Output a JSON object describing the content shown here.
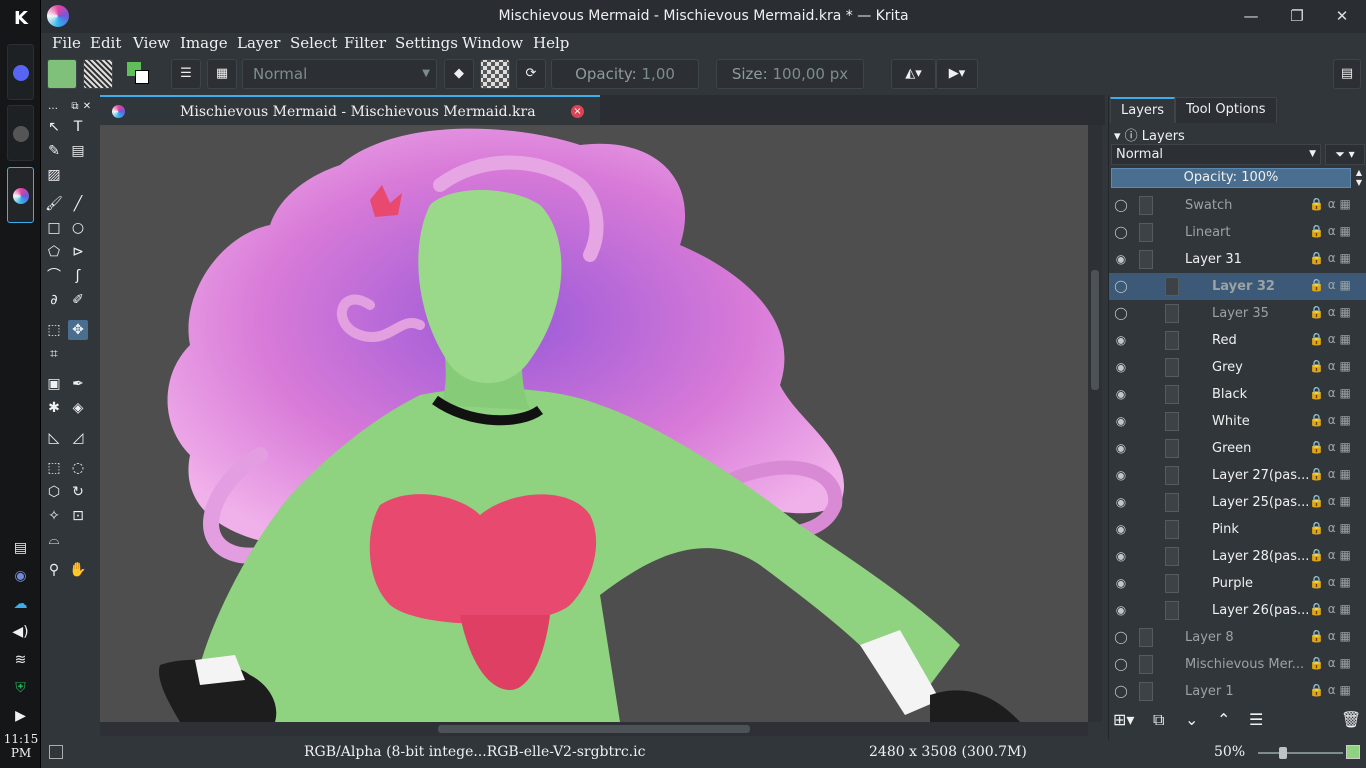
{
  "window": {
    "title": "Mischievous Mermaid - Mischievous Mermaid.kra * — Krita",
    "minimize": "—",
    "restore": "❐",
    "close": "✕"
  },
  "taskbar": {
    "launcher": "K",
    "clock": "11:15 PM"
  },
  "menu": [
    "File",
    "Edit",
    "View",
    "Image",
    "Layer",
    "Select",
    "Filter",
    "Settings",
    "Window",
    "Help"
  ],
  "toolbar": {
    "blend_mode": "Normal",
    "opacity_label": "Opacity:",
    "opacity_value": "1,00",
    "size_label": "Size:",
    "size_value": "100,00 px"
  },
  "canvas_tab": {
    "label": "Mischievous Mermaid - Mischievous Mermaid.kra"
  },
  "dock": {
    "tabs": [
      "Layers",
      "Tool Options"
    ],
    "header": "Layers",
    "blend_mode": "Normal",
    "opacity": "Opacity:  100%",
    "layers": [
      {
        "name": "Swatch",
        "indent": 0,
        "visible": false,
        "selected": false
      },
      {
        "name": "Lineart",
        "indent": 0,
        "visible": false,
        "selected": false
      },
      {
        "name": "Layer 31",
        "indent": 0,
        "visible": true,
        "selected": false
      },
      {
        "name": "Layer 32",
        "indent": 1,
        "visible": false,
        "selected": true
      },
      {
        "name": "Layer 35",
        "indent": 1,
        "visible": false,
        "selected": false
      },
      {
        "name": "Red",
        "indent": 1,
        "visible": true,
        "selected": false
      },
      {
        "name": "Grey",
        "indent": 1,
        "visible": true,
        "selected": false
      },
      {
        "name": "Black",
        "indent": 1,
        "visible": true,
        "selected": false
      },
      {
        "name": "White",
        "indent": 1,
        "visible": true,
        "selected": false
      },
      {
        "name": "Green",
        "indent": 1,
        "visible": true,
        "selected": false
      },
      {
        "name": "Layer 27(pas...",
        "indent": 1,
        "visible": true,
        "selected": false
      },
      {
        "name": "Layer 25(pas...",
        "indent": 1,
        "visible": true,
        "selected": false
      },
      {
        "name": "Pink",
        "indent": 1,
        "visible": true,
        "selected": false
      },
      {
        "name": "Layer 28(pas...",
        "indent": 1,
        "visible": true,
        "selected": false
      },
      {
        "name": "Purple",
        "indent": 1,
        "visible": true,
        "selected": false
      },
      {
        "name": "Layer 26(pas...",
        "indent": 1,
        "visible": true,
        "selected": false
      },
      {
        "name": "Layer 8",
        "indent": 0,
        "visible": false,
        "selected": false
      },
      {
        "name": "Mischievous Mer...",
        "indent": 0,
        "visible": false,
        "selected": false
      },
      {
        "name": "Layer 1",
        "indent": 0,
        "visible": false,
        "selected": false
      }
    ]
  },
  "status": {
    "color_profile": "RGB/Alpha (8-bit intege...RGB-elle-V2-srgbtrc.ic",
    "dimensions": "2480 x 3508 (300.7M)",
    "zoom": "50%"
  },
  "colors": {
    "accent": "#3daee9",
    "selection": "#3c5a78",
    "canvas_bg": "#4e4e4e",
    "hair": "#d97ad6",
    "skin": "#8fd27f",
    "top": "#e8496e"
  }
}
